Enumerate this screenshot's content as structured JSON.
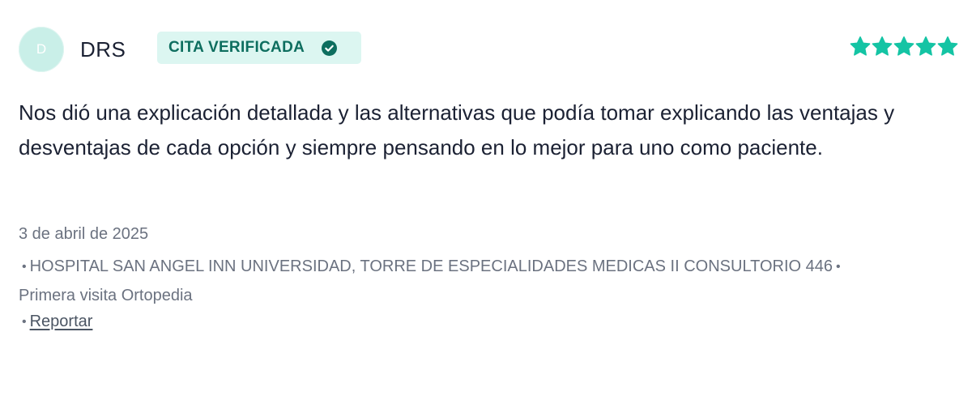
{
  "review": {
    "avatar_initial": "D",
    "author": "DRS",
    "badge_label": "CITA VERIFICADA",
    "badge_icon": "check-circle-icon",
    "rating": 5,
    "rating_max": 5,
    "comment": "Nos dió una explicación detallada y las alternativas que podía tomar explicando las ventajas y desventajas de cada opción y siempre pensando en lo mejor para uno como paciente.",
    "date": "3 de abril de 2025",
    "bullet": "•",
    "location": "HOSPITAL SAN ANGEL INN UNIVERSIDAD, TORRE DE ESPECIALIDADES MEDICAS II CONSULTORIO 446",
    "visit_type": "Primera visita Ortopedia",
    "report_label": "Reportar"
  },
  "colors": {
    "accent": "#14c4a4",
    "badge_bg": "#dcf6f1",
    "badge_text": "#0d6e5f",
    "avatar_bg": "#c9efe8",
    "meta_text": "#6b7280",
    "body_text": "#1b2133"
  }
}
